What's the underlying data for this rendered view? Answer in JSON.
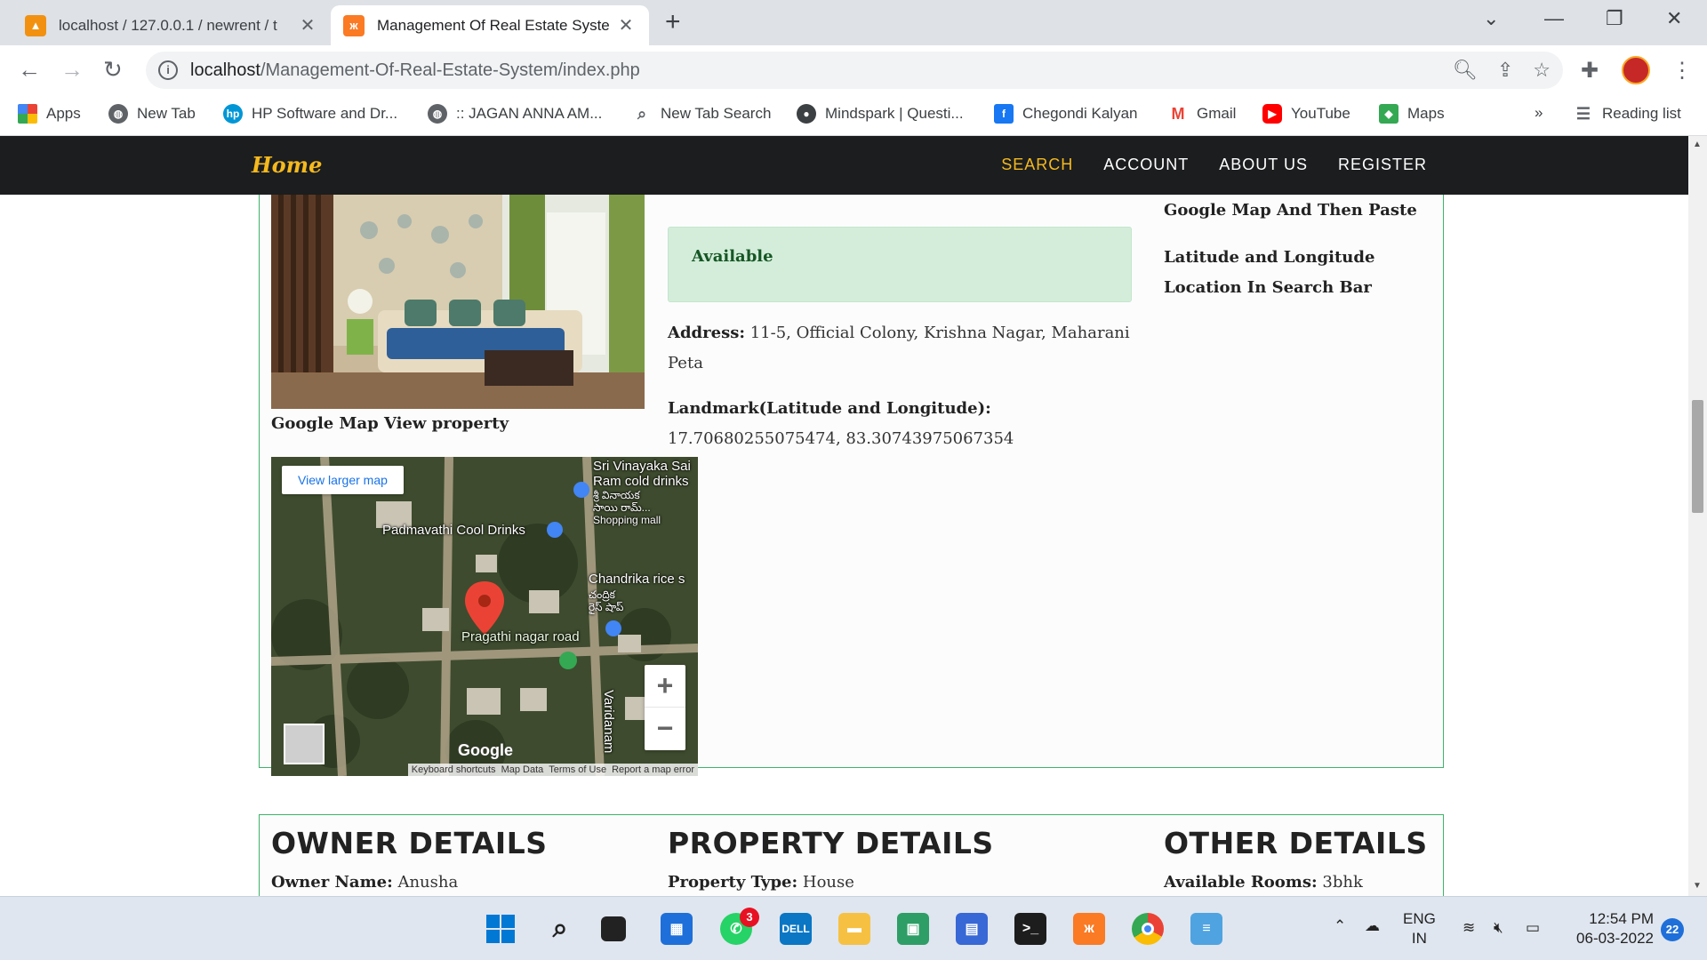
{
  "browser": {
    "tabs": [
      {
        "title": "localhost / 127.0.0.1 / newrent / t",
        "icon": "phpmyadmin-icon",
        "close": "✕"
      },
      {
        "title": "Management Of Real Estate Syste",
        "icon": "xampp-icon",
        "close": "✕"
      }
    ],
    "new_tab": "+",
    "url_host": "localhost",
    "url_path": "/Management-Of-Real-Estate-System/index.php",
    "bookmarks": [
      {
        "label": "Apps",
        "icon": "apps-grid-icon"
      },
      {
        "label": "New Tab",
        "icon": "globe-icon"
      },
      {
        "label": "HP Software and Dr...",
        "icon": "hp-icon"
      },
      {
        "label": ":: JAGAN ANNA AM...",
        "icon": "globe-icon"
      },
      {
        "label": "New Tab Search",
        "icon": "search-icon"
      },
      {
        "label": "Mindspark | Questi...",
        "icon": "mindspark-icon"
      },
      {
        "label": "Chegondi Kalyan",
        "icon": "facebook-icon"
      },
      {
        "label": "Gmail",
        "icon": "gmail-icon"
      },
      {
        "label": "YouTube",
        "icon": "youtube-icon"
      },
      {
        "label": "Maps",
        "icon": "maps-icon"
      }
    ],
    "more_bookmarks": "»",
    "reading_list": "Reading list"
  },
  "site": {
    "brand": "Home",
    "nav": [
      "SEARCH",
      "ACCOUNT",
      "ABOUT US",
      "REGISTER"
    ],
    "active_nav": "SEARCH"
  },
  "property": {
    "map_view_label": "Google Map View property",
    "status": "Available",
    "address_label": "Address:",
    "address_value": "11-5, Official Colony, Krishna Nagar, Maharani Peta",
    "landmark_label": "Landmark(Latitude and Longitude):",
    "landmark_value": "17.70680255075474, 83.30743975067354",
    "note_line1": "Google Map And Then Paste",
    "note_line2": "Latitude and Longitude Location In Search Bar"
  },
  "map": {
    "larger_map": "View larger map",
    "labels": {
      "sri_vinayaka": "Sri Vinayaka Sai",
      "ram_cold": "Ram cold drinks",
      "telugu1": "శ్రీ వినాయక",
      "telugu2": "సాయి రామ్...",
      "shopping_mall": "Shopping mall",
      "padmavathi": "Padmavathi Cool Drinks",
      "chandrika": "Chandrika rice s",
      "telugu3": "చంద్రిక",
      "telugu4": "రైస్ షాప్",
      "pragathi": "Pragathi nagar road",
      "varidanam": "Varidanam"
    },
    "zoom_in": "+",
    "zoom_out": "−",
    "google": "Google",
    "footer": [
      "Keyboard shortcuts",
      "Map Data",
      "Terms of Use",
      "Report a map error"
    ]
  },
  "sections": {
    "owner_heading": "OWNER DETAILS",
    "owner_name_label": "Owner Name:",
    "owner_name_value": "Anusha",
    "property_heading": "PROPERTY DETAILS",
    "property_type_label": "Property Type:",
    "property_type_value": "House",
    "other_heading": "OTHER DETAILS",
    "rooms_label": "Available Rooms:",
    "rooms_value": "3bhk"
  },
  "taskbar": {
    "whatsapp_badge": "3",
    "lang_line1": "ENG",
    "lang_line2": "IN",
    "time": "12:54 PM",
    "date": "06-03-2022",
    "notifications": "22"
  },
  "colors": {
    "accent": "#f5b91e",
    "nav_bg": "#1b1d1f",
    "card_border": "#3fb36b",
    "alert_bg": "#d4edda",
    "alert_text": "#155724"
  }
}
